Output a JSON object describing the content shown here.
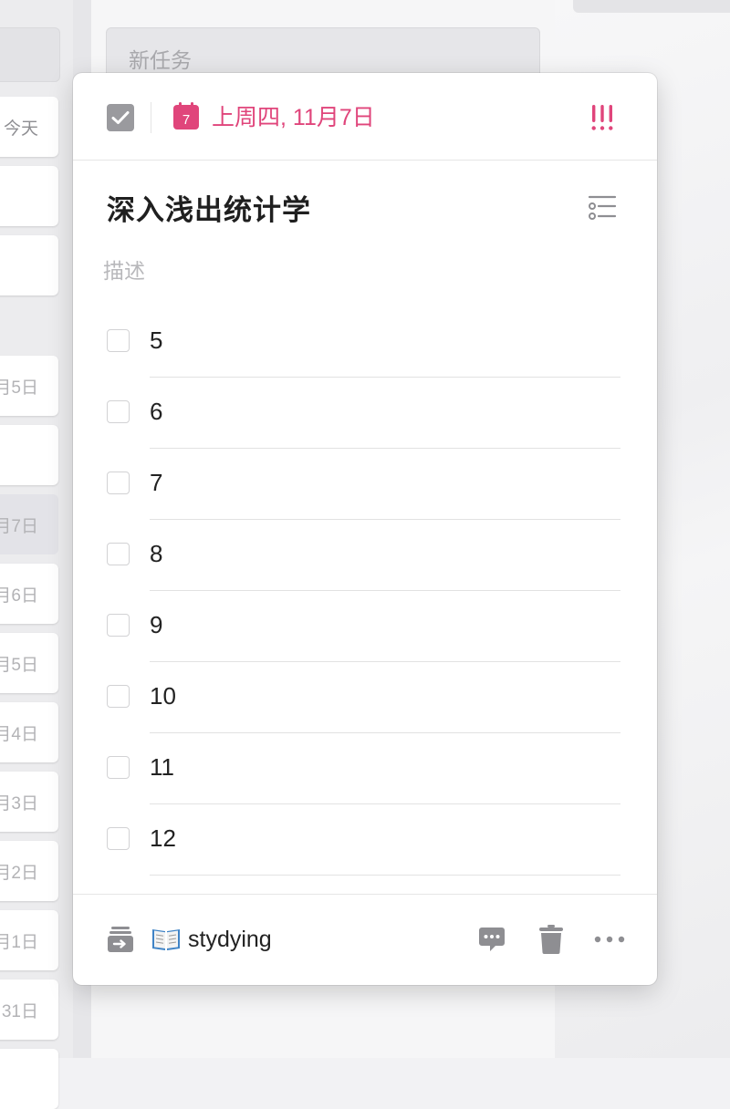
{
  "background": {
    "new_task_placeholder": "新任务",
    "cards": [
      {
        "label": "今天"
      },
      {
        "label": ""
      },
      {
        "label": ""
      },
      {
        "label": "月5日"
      },
      {
        "label": ""
      },
      {
        "label": "月7日"
      },
      {
        "label": "月6日"
      },
      {
        "label": "月5日"
      },
      {
        "label": "月4日"
      },
      {
        "label": "月3日"
      },
      {
        "label": "月2日"
      },
      {
        "label": "月1日"
      },
      {
        "label": "31日"
      }
    ]
  },
  "task": {
    "completed": true,
    "due_date_label": "上周四, 11月7日",
    "calendar_day": "7",
    "priority_label": "!!!",
    "title": "深入浅出统计学",
    "description_placeholder": "描述",
    "subtasks": [
      {
        "text": "5",
        "checked": false
      },
      {
        "text": "6",
        "checked": false
      },
      {
        "text": "7",
        "checked": false
      },
      {
        "text": "8",
        "checked": false
      },
      {
        "text": "9",
        "checked": false
      },
      {
        "text": "10",
        "checked": false
      },
      {
        "text": "11",
        "checked": false
      },
      {
        "text": "12",
        "checked": false
      }
    ],
    "list": {
      "emoji": "📖",
      "name": "stydying"
    }
  },
  "icons": {
    "completed_checkbox": "checkmark-icon",
    "calendar": "calendar-icon",
    "priority": "high-priority-icon",
    "subtask_mode": "checklist-icon",
    "move_list": "move-to-list-icon",
    "comment": "comment-icon",
    "delete": "trash-icon",
    "more": "more-icon"
  },
  "colors": {
    "accent": "#e0457b",
    "checkbox_done": "#9a9a9e",
    "icon_gray": "#8e8e92"
  }
}
